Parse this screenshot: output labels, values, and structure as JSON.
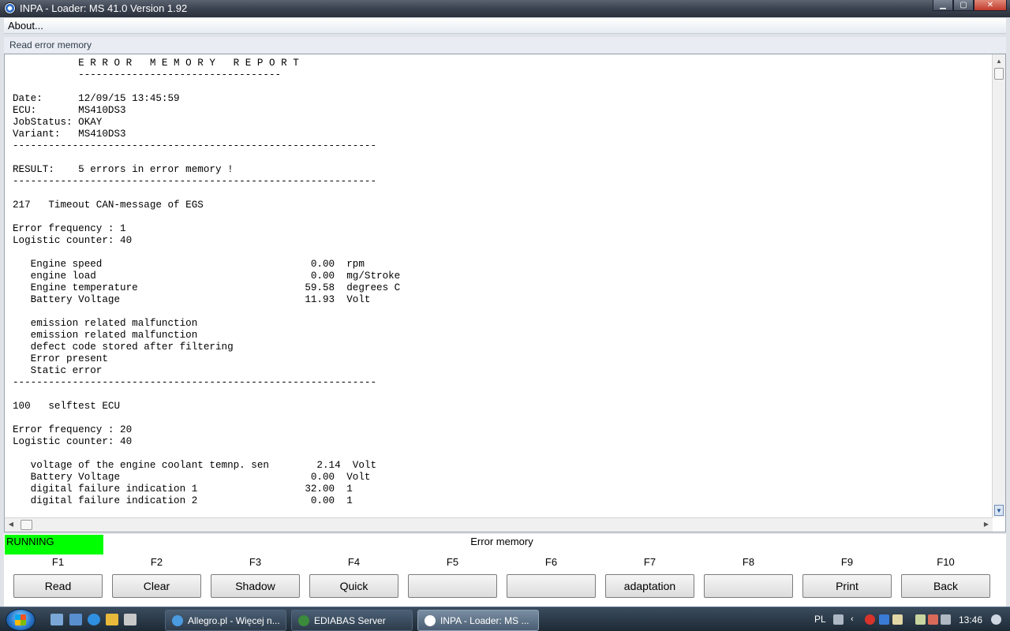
{
  "window": {
    "title": "INPA - Loader:  MS 41.0 Version 1.92",
    "min_glyph": "▁",
    "max_glyph": "▢",
    "close_glyph": "✕"
  },
  "menu": {
    "about": "About..."
  },
  "subtitle": "Read error memory",
  "report": {
    "lines": [
      "           E R R O R   M E M O R Y   R E P O R T",
      "           ----------------------------------",
      "",
      "Date:      12/09/15 13:45:59",
      "ECU:       MS410DS3",
      "JobStatus: OKAY",
      "Variant:   MS410DS3",
      "-------------------------------------------------------------",
      "",
      "RESULT:    5 errors in error memory !",
      "-------------------------------------------------------------",
      "",
      "217   Timeout CAN-message of EGS",
      "",
      "Error frequency : 1",
      "Logistic counter: 40",
      "",
      "   Engine speed                                   0.00  rpm",
      "   engine load                                    0.00  mg/Stroke",
      "   Engine temperature                            59.58  degrees C",
      "   Battery Voltage                               11.93  Volt",
      "",
      "   emission related malfunction",
      "   emission related malfunction",
      "   defect code stored after filtering",
      "   Error present",
      "   Static error",
      "-------------------------------------------------------------",
      "",
      "100   selftest ECU",
      "",
      "Error frequency : 20",
      "Logistic counter: 40",
      "",
      "   voltage of the engine coolant temnp. sen        2.14  Volt",
      "   Battery Voltage                                0.00  Volt",
      "   digital failure indication 1                  32.00  1",
      "   digital failure indication 2                   0.00  1"
    ]
  },
  "scroll": {
    "up_glyph": "▲",
    "down_glyph": "▼",
    "left_glyph": "◀",
    "right_glyph": "▶"
  },
  "status": {
    "state": "RUNNING",
    "state_color": "#00ff00",
    "title": "Error memory"
  },
  "fkeys": [
    {
      "key": "F1",
      "label": "Read"
    },
    {
      "key": "F2",
      "label": "Clear"
    },
    {
      "key": "F3",
      "label": "Shadow"
    },
    {
      "key": "F4",
      "label": "Quick"
    },
    {
      "key": "F5",
      "label": ""
    },
    {
      "key": "F6",
      "label": ""
    },
    {
      "key": "F7",
      "label": "adaptation"
    },
    {
      "key": "F8",
      "label": ""
    },
    {
      "key": "F9",
      "label": "Print"
    },
    {
      "key": "F10",
      "label": "Back"
    }
  ],
  "taskbar": {
    "tasks": [
      {
        "label": "Allegro.pl - Więcej n...",
        "icon": "chrome-icon",
        "active": false
      },
      {
        "label": "EDIABAS Server",
        "icon": "ediabas-icon",
        "active": false
      },
      {
        "label": "INPA - Loader:  MS ...",
        "icon": "bmw-icon",
        "active": true
      }
    ],
    "language": "PL",
    "time": "13:46"
  }
}
